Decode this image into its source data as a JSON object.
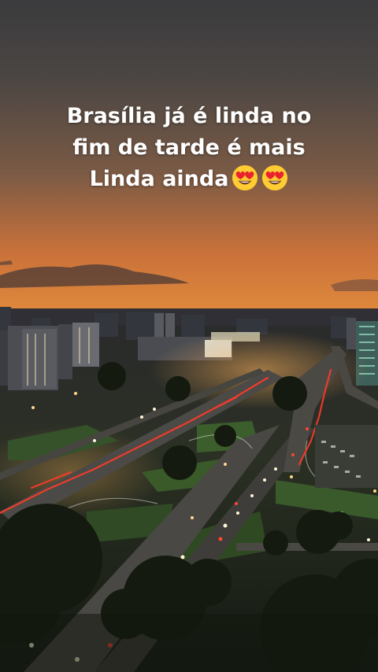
{
  "story": {
    "caption": {
      "line1": "Brasília já é linda no",
      "line2": "fim de tarde é mais",
      "line3": "Linda ainda"
    },
    "emojis": [
      "heart-eyes-emoji",
      "heart-eyes-emoji"
    ]
  }
}
